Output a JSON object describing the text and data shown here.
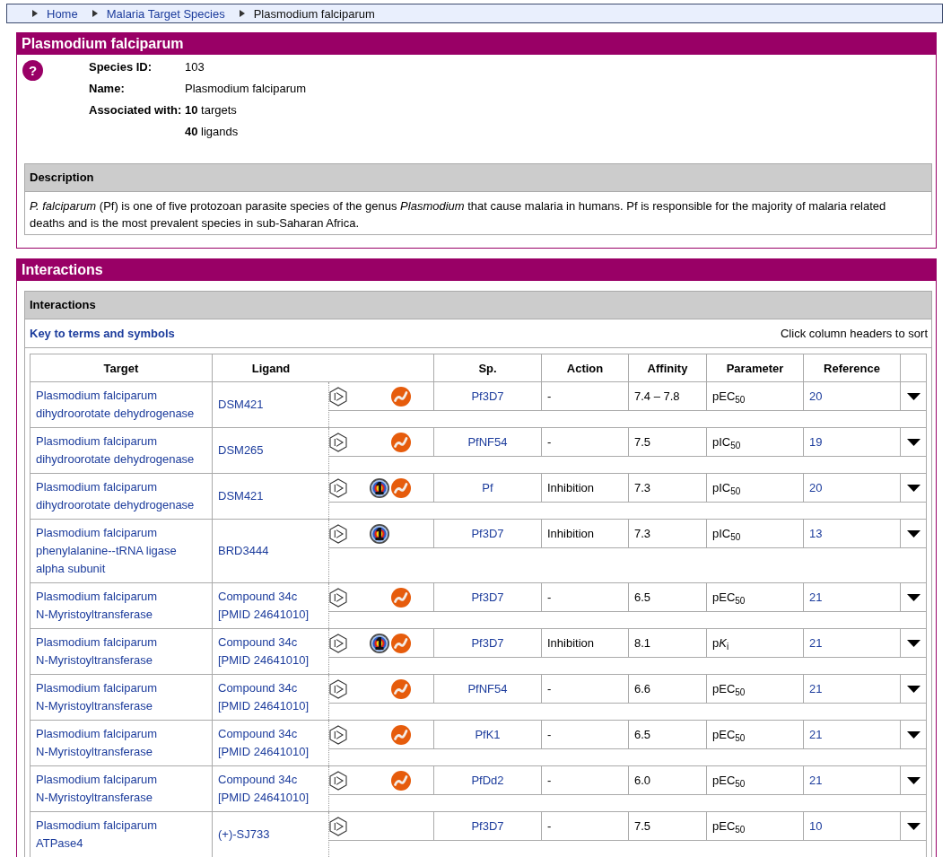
{
  "breadcrumb": [
    {
      "label": "Home",
      "current": false
    },
    {
      "label": "Malaria Target Species",
      "current": false
    },
    {
      "label": "Plasmodium falciparum",
      "current": true
    }
  ],
  "species": {
    "title": "Plasmodium falciparum",
    "help_icon": "?",
    "fields": [
      {
        "label": "Species ID:",
        "values": [
          "103"
        ]
      },
      {
        "label": "Name:",
        "values": [
          "Plasmodium falciparum"
        ]
      },
      {
        "label": "Associated with:",
        "values": [
          "**10** targets",
          "**40** ligands"
        ]
      }
    ],
    "description": {
      "heading": "Description",
      "text": "*P. falciparum* (Pf) is one of five protozoan parasite species of the genus *Plasmodium* that cause malaria in humans. Pf is responsible for the majority of malaria related deaths and is the most prevalent species in sub-Saharan Africa."
    }
  },
  "interactions": {
    "title": "Interactions",
    "heading": "Interactions",
    "key_link": "Key to terms and symbols",
    "sort_hint": "Click column headers to sort",
    "columns": [
      "Target",
      "Ligand",
      "Sp.",
      "Action",
      "Affinity",
      "Parameter",
      "Reference"
    ],
    "rows": [
      {
        "target": [
          "Plasmodium falciparum",
          "dihydroorotate dehydrogenase"
        ],
        "ligand": [
          "DSM421"
        ],
        "markers": {
          "hexagon": true,
          "bullseye": false,
          "wave": true
        },
        "species": "Pf3D7",
        "action": "-",
        "affinity": "7.4 – 7.8",
        "parameter": [
          "pEC$_{50}$"
        ],
        "reference": "20"
      },
      {
        "target": [
          "Plasmodium falciparum",
          "dihydroorotate dehydrogenase"
        ],
        "ligand": [
          "DSM265"
        ],
        "markers": {
          "hexagon": true,
          "bullseye": false,
          "wave": true
        },
        "species": "PfNF54",
        "action": "-",
        "affinity": "7.5",
        "parameter": [
          "pIC$_{50}$"
        ],
        "reference": "19"
      },
      {
        "target": [
          "Plasmodium falciparum",
          "dihydroorotate dehydrogenase"
        ],
        "ligand": [
          "DSM421"
        ],
        "markers": {
          "hexagon": true,
          "bullseye": true,
          "wave": true
        },
        "species": "Pf",
        "action": "Inhibition",
        "affinity": "7.3",
        "parameter": [
          "pIC$_{50}$"
        ],
        "reference": "20"
      },
      {
        "target": [
          "Plasmodium falciparum",
          "phenylalanine--tRNA ligase",
          "alpha subunit"
        ],
        "ligand": [
          "BRD3444"
        ],
        "markers": {
          "hexagon": true,
          "bullseye": true,
          "wave": false
        },
        "species": "Pf3D7",
        "action": "Inhibition",
        "affinity": "7.3",
        "parameter": [
          "pIC$_{50}$"
        ],
        "reference": "13"
      },
      {
        "target": [
          "Plasmodium falciparum",
          "N-Myristoyltransferase"
        ],
        "ligand": [
          "Compound 34c",
          "[PMID 24641010]"
        ],
        "markers": {
          "hexagon": true,
          "bullseye": false,
          "wave": true
        },
        "species": "Pf3D7",
        "action": "-",
        "affinity": "6.5",
        "parameter": [
          "pEC$_{50}$"
        ],
        "reference": "21"
      },
      {
        "target": [
          "Plasmodium falciparum",
          "N-Myristoyltransferase"
        ],
        "ligand": [
          "Compound 34c",
          "[PMID 24641010]"
        ],
        "markers": {
          "hexagon": true,
          "bullseye": true,
          "wave": true
        },
        "species": "Pf3D7",
        "action": "Inhibition",
        "affinity": "8.1",
        "parameter": [
          "p",
          "*K*$_{i}$"
        ],
        "reference": "21"
      },
      {
        "target": [
          "Plasmodium falciparum",
          "N-Myristoyltransferase"
        ],
        "ligand": [
          "Compound 34c",
          "[PMID 24641010]"
        ],
        "markers": {
          "hexagon": true,
          "bullseye": false,
          "wave": true
        },
        "species": "PfNF54",
        "action": "-",
        "affinity": "6.6",
        "parameter": [
          "pEC$_{50}$"
        ],
        "reference": "21"
      },
      {
        "target": [
          "Plasmodium falciparum",
          "N-Myristoyltransferase"
        ],
        "ligand": [
          "Compound 34c",
          "[PMID 24641010]"
        ],
        "markers": {
          "hexagon": true,
          "bullseye": false,
          "wave": true
        },
        "species": "PfK1",
        "action": "-",
        "affinity": "6.5",
        "parameter": [
          "pEC$_{50}$"
        ],
        "reference": "21"
      },
      {
        "target": [
          "Plasmodium falciparum",
          "N-Myristoyltransferase"
        ],
        "ligand": [
          "Compound 34c",
          "[PMID 24641010]"
        ],
        "markers": {
          "hexagon": true,
          "bullseye": false,
          "wave": true
        },
        "species": "PfDd2",
        "action": "-",
        "affinity": "6.0",
        "parameter": [
          "pEC$_{50}$"
        ],
        "reference": "21"
      },
      {
        "target": [
          "Plasmodium falciparum",
          "ATPase4"
        ],
        "ligand": [
          "(+)-SJ733"
        ],
        "markers": {
          "hexagon": true,
          "bullseye": false,
          "wave": false
        },
        "species": "Pf3D7",
        "action": "-",
        "affinity": "7.5",
        "parameter": [
          "pEC$_{50}$"
        ],
        "reference": "10"
      }
    ]
  }
}
